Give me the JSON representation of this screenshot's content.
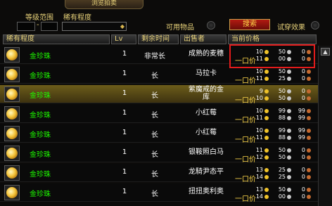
{
  "window": {
    "title": "浏览拍卖"
  },
  "filters": {
    "level_range_label": "等级范围",
    "rarity_label": "稀有程度",
    "usable_label": "可用物品",
    "search_label": "搜索",
    "preview_label": "试穿效果",
    "level_min": "",
    "level_max": "",
    "rarity_value": ""
  },
  "columns": [
    "稀有程度",
    "Lv",
    "剩余时间",
    "出售者",
    "当前价格"
  ],
  "bid_label": "一口价",
  "rows": [
    {
      "name": "金珍珠",
      "lv": "1",
      "time": "非常长",
      "seller": "成熟的麦穗",
      "bid": [
        "10",
        "50",
        "0"
      ],
      "buyout": [
        "11",
        "00",
        "0"
      ]
    },
    {
      "name": "金珍珠",
      "lv": "1",
      "time": "长",
      "seller": "马拉卡",
      "bid": [
        "10",
        "50",
        "0"
      ],
      "buyout": [
        "11",
        "25",
        "0"
      ]
    },
    {
      "name": "金珍珠",
      "lv": "1",
      "time": "长",
      "seller": "萦魔戒的金库",
      "bid": [
        "9",
        "50",
        "0"
      ],
      "buyout": [
        "10",
        "50",
        "0"
      ]
    },
    {
      "name": "金珍珠",
      "lv": "1",
      "time": "长",
      "seller": "小红莓",
      "bid": [
        "10",
        "99",
        "99"
      ],
      "buyout": [
        "11",
        "88",
        "99"
      ]
    },
    {
      "name": "金珍珠",
      "lv": "1",
      "time": "长",
      "seller": "小红莓",
      "bid": [
        "10",
        "99",
        "99"
      ],
      "buyout": [
        "11",
        "88",
        "99"
      ]
    },
    {
      "name": "金珍珠",
      "lv": "1",
      "time": "长",
      "seller": "银鞍照白马",
      "bid": [
        "11",
        "50",
        "0"
      ],
      "buyout": [
        "12",
        "50",
        "0"
      ]
    },
    {
      "name": "金珍珠",
      "lv": "1",
      "time": "长",
      "seller": "龙騎尹态平",
      "bid": [
        "13",
        "25",
        "0"
      ],
      "buyout": [
        "14",
        "25",
        "0"
      ]
    },
    {
      "name": "金珍珠",
      "lv": "1",
      "time": "长",
      "seller": "扭扭奥利奥",
      "bid": [
        "13",
        "50",
        "0"
      ],
      "buyout": [
        "14",
        "00",
        "0"
      ]
    }
  ]
}
